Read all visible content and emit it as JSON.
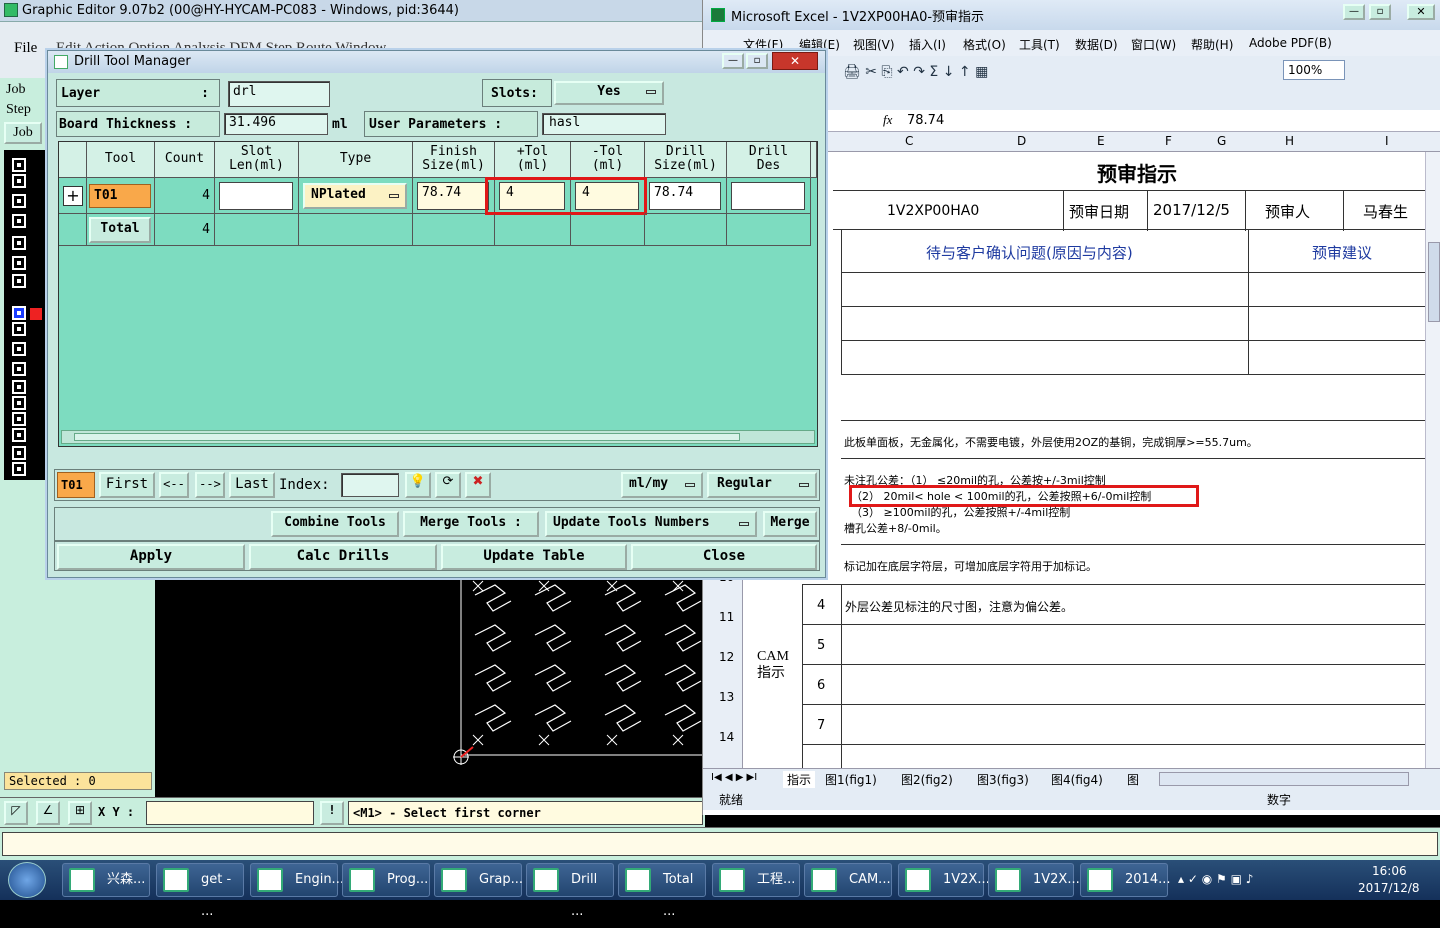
{
  "graphic_editor": {
    "title": "Graphic Editor 9.07b2 (00@HY-HYCAM-PC083 - Windows, pid:3644)",
    "menu_file": "File",
    "menu_rest": "Edit Action Option Analysis DFM Step Route Window",
    "left_job": "Job",
    "left_step": "Step",
    "left_job_btn": "Job",
    "selected": "Selected : 0",
    "xy_label": "X Y :",
    "status_message": "<M1> - Select first corner",
    "status_btn": "!"
  },
  "drill_tool_manager": {
    "title": "Drill Tool Manager",
    "layer_label": "Layer",
    "layer_colon": ":",
    "layer_value": "drl",
    "slots_label": "Slots:",
    "slots_value": "Yes",
    "board_thickness_label": "Board Thickness :",
    "board_thickness_value": "31.496",
    "board_thickness_unit": "ml",
    "user_params_label": "User Parameters :",
    "user_params_value": "hasl",
    "columns": [
      "Tool",
      "Count",
      "Slot\nLen(ml)",
      "Type",
      "Finish\nSize(ml)",
      "+Tol\n(ml)",
      "-Tol\n(ml)",
      "Drill\nSize(ml)",
      "Drill\nDes"
    ],
    "row": {
      "add": "+",
      "tool": "T01",
      "count": "4",
      "slot_len": "",
      "type": "NPlated",
      "finish_size": "78.74",
      "plus_tol": "4",
      "minus_tol": "4",
      "drill_size": "78.74",
      "drill_des": ""
    },
    "total_label": "Total",
    "total_count": "4",
    "nav_tool": "T01",
    "nav_first": "First",
    "nav_prev": "<--",
    "nav_next": "-->",
    "nav_last": "Last",
    "index_label": "Index:",
    "unit_select": "ml/my",
    "mode_select": "Regular",
    "combine_tools": "Combine Tools",
    "merge_tools": "Merge Tools :",
    "update_tools_numbers": "Update Tools Numbers",
    "merge": "Merge",
    "apply": "Apply",
    "calc_drills": "Calc Drills",
    "update_table": "Update Table",
    "close": "Close"
  },
  "excel": {
    "title": "Microsoft Excel - 1V2XP00HA0-预审指示",
    "menus": [
      "文件(F)",
      "编辑(E)",
      "视图(V)",
      "插入(I)",
      "格式(O)",
      "工具(T)",
      "数据(D)",
      "窗口(W)",
      "帮助(H)",
      "Adobe PDF(B)"
    ],
    "zoom": "100%",
    "formula_fx": "fx",
    "formula_value": "78.74",
    "col_headers": [
      "C",
      "D",
      "E",
      "F",
      "G",
      "H",
      "I"
    ],
    "sheet_title": "预审指示",
    "part_number": "1V2XP00HA0",
    "review_date_label": "预审日期",
    "review_date": "2017/12/5",
    "reviewer_label": "预审人",
    "reviewer": "马春生",
    "issues_header": "待与客户确认问题(原因与内容)",
    "suggestion_header": "预审建议",
    "note_board": "此板单面板，无金属化，不需要电镀，外层使用2OZ的基铜，完成铜厚>=55.7um。",
    "note_tol_head": "未注孔公差：（1） ≤20mil的孔，公差按+/-3mil控制",
    "note_tol_2": "（2） 20mil< hole < 100mil的孔，公差按照+6/-0mil控制",
    "note_tol_3": "（3） ≥100mil的孔，公差按照+/-4mil控制",
    "note_slot": "槽孔公差+8/-0mil。",
    "note_mark": "标记加在底层字符层，可增加底层字符用于加标记。",
    "row_numbers": [
      "10",
      "11",
      "12",
      "13",
      "14"
    ],
    "cam_label": "CAM\n指示",
    "items": [
      {
        "num": "4",
        "text": "外层公差见标注的尺寸图，注意为偏公差。"
      },
      {
        "num": "5",
        "text": ""
      },
      {
        "num": "6",
        "text": ""
      },
      {
        "num": "7",
        "text": ""
      }
    ],
    "sheet_tabs": [
      "指示",
      "图1(fig1)",
      "图2(fig2)",
      "图3(fig3)",
      "图4(fig4)",
      "图"
    ],
    "status_ready": "就绪",
    "status_num": "数字"
  },
  "taskbar": {
    "items": [
      "兴森...",
      "get - ...",
      "Engin...",
      "Prog...",
      "Grap...",
      "Drill ...",
      "Total ...",
      "工程...",
      "CAM...",
      "1V2X...",
      "1V2X...",
      "2014..."
    ],
    "time": "16:06",
    "date": "2017/12/8"
  }
}
